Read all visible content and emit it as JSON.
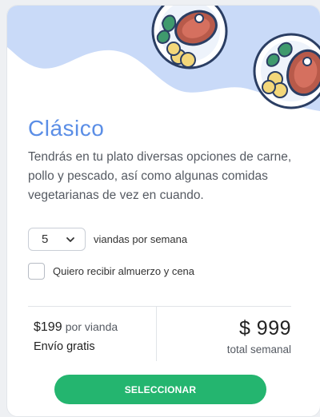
{
  "plan": {
    "title": "Clásico",
    "description": "Tendrás en tu plato diversas opciones de carne, pollo y pescado, así como algunas comidas vegetarianas de vez en cuando."
  },
  "quantity": {
    "selected": "5",
    "label": "viandas por semana"
  },
  "lunch_dinner": {
    "label": "Quiero recibir almuerzo y cena",
    "checked": false
  },
  "pricing": {
    "per_unit_amount": "$199",
    "per_unit_label": "por vianda",
    "shipping": "Envío gratis",
    "total_amount": "$ 999",
    "total_label": "total semanal"
  },
  "cta": {
    "label": "SELECCIONAR"
  },
  "colors": {
    "accent": "#5b8ee6",
    "wave": "#c9daf8",
    "button": "#24b56f"
  },
  "icons": [
    "steak-plate-illustration",
    "chevron-down-icon"
  ]
}
